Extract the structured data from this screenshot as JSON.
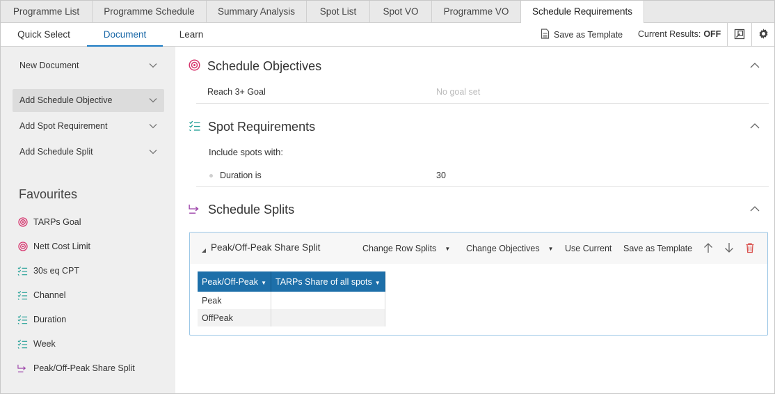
{
  "tabs": [
    "Programme List",
    "Programme Schedule",
    "Summary Analysis",
    "Spot List",
    "Spot VO",
    "Programme VO",
    "Schedule Requirements"
  ],
  "active_tab": "Schedule Requirements",
  "subtabs": [
    "Quick Select",
    "Document",
    "Learn"
  ],
  "active_subtab": "Document",
  "toolbar": {
    "save_as_template": "Save as Template",
    "current_results_label": "Current Results:",
    "current_results_value": "OFF",
    "icons": [
      "popout-icon",
      "gear-icon"
    ]
  },
  "sidebar": {
    "items": [
      {
        "label": "New Document"
      },
      {
        "label": "Add Schedule Objective"
      },
      {
        "label": "Add Spot Requirement"
      },
      {
        "label": "Add Schedule Split"
      }
    ],
    "favourites_title": "Favourites",
    "favourites": [
      {
        "label": "TARPs Goal",
        "icon": "target-icon"
      },
      {
        "label": "Nett Cost Limit",
        "icon": "target-icon"
      },
      {
        "label": "30s eq CPT",
        "icon": "checklist-icon"
      },
      {
        "label": "Channel",
        "icon": "checklist-icon"
      },
      {
        "label": "Duration",
        "icon": "checklist-icon"
      },
      {
        "label": "Week",
        "icon": "checklist-icon"
      },
      {
        "label": "Peak/Off-Peak Share Split",
        "icon": "split-icon"
      }
    ]
  },
  "objectives": {
    "title": "Schedule Objectives",
    "goal_label": "Reach 3+ Goal",
    "goal_value": "No goal set"
  },
  "spot_requirements": {
    "title": "Spot Requirements",
    "intro": "Include spots with:",
    "rule_label": "Duration is",
    "rule_value": "30"
  },
  "schedule_splits": {
    "title": "Schedule Splits",
    "panel": {
      "title": "Peak/Off-Peak Share Split",
      "change_row_splits": "Change Row Splits",
      "change_objectives": "Change Objectives",
      "use_current": "Use Current",
      "save_as_template": "Save as Template",
      "columns": [
        "Peak/Off-Peak",
        "TARPs Share of all spots"
      ],
      "rows": [
        {
          "name": "Peak",
          "value": ""
        },
        {
          "name": "OffPeak",
          "value": ""
        }
      ]
    }
  },
  "colors": {
    "accent": "#1b7ac2",
    "header_blue": "#1d6fa9",
    "target_pink": "#d6336c",
    "checklist_teal": "#1e9e95",
    "split_purple": "#9b3fa8",
    "delete_red": "#d9534f"
  }
}
